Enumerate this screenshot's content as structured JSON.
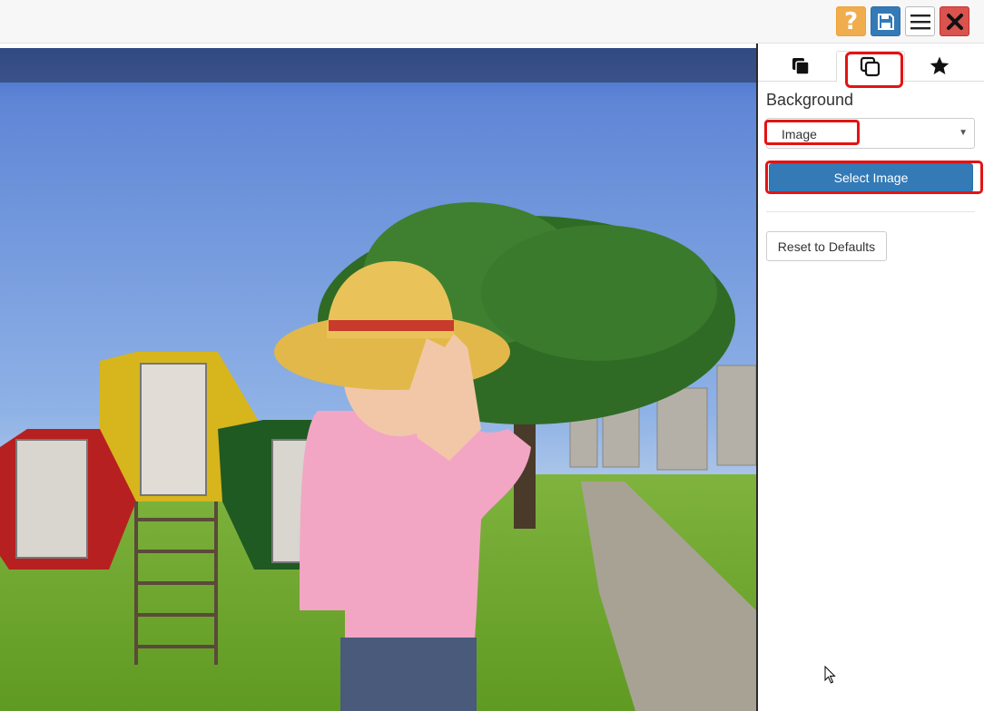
{
  "toolbar": {
    "help_glyph": "?",
    "buttons": [
      {
        "name": "help",
        "icon": "question-icon",
        "color": "#f0ad4e"
      },
      {
        "name": "save",
        "icon": "floppy-disk-icon",
        "color": "#337ab7"
      },
      {
        "name": "menu",
        "icon": "hamburger-menu-icon",
        "color": "#ffffff"
      },
      {
        "name": "close",
        "icon": "close-x-icon",
        "color": "#d9534f"
      }
    ]
  },
  "panel": {
    "tabs": [
      {
        "name": "layers",
        "icon": "layers-filled-icon",
        "active": false
      },
      {
        "name": "background",
        "icon": "copy-outline-icon",
        "active": true
      },
      {
        "name": "effects",
        "icon": "star-icon",
        "active": false
      }
    ],
    "section_label": "Background",
    "background_select": {
      "value": "Image"
    },
    "select_image_label": "Select Image",
    "reset_label": "Reset to Defaults"
  },
  "highlight_color": "#e41313",
  "accent_color": "#337ab7"
}
